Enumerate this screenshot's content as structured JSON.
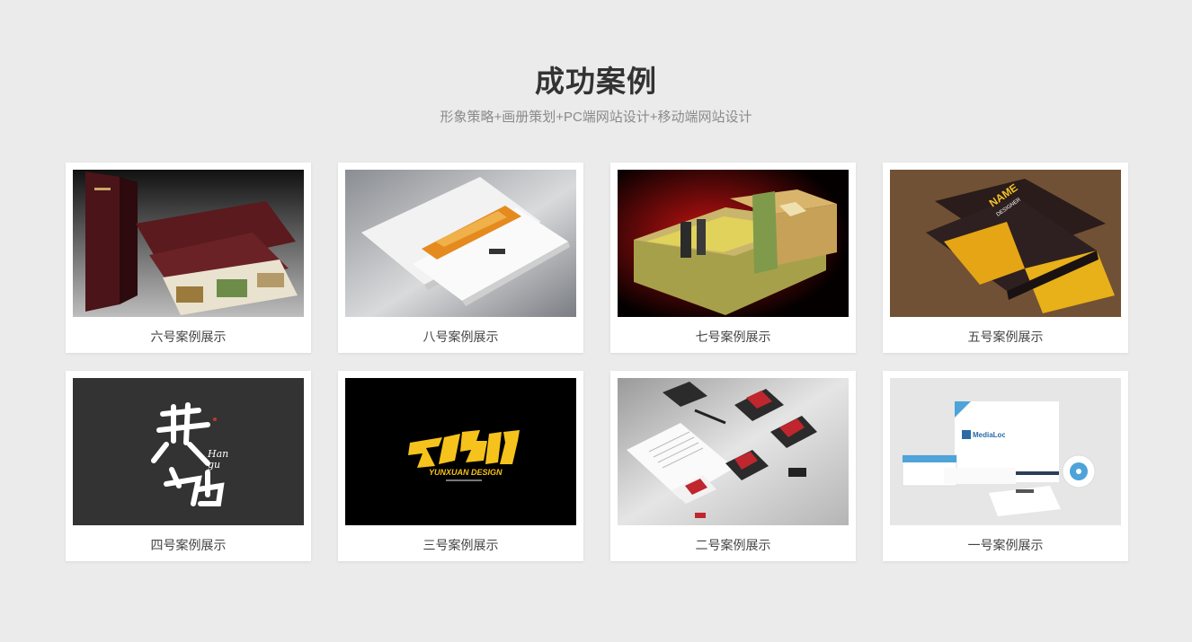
{
  "section": {
    "title": "成功案例",
    "subtitle": "形象策略+画册策划+PC端网站设计+移动端网站设计"
  },
  "cases": [
    {
      "label": "六号案例展示",
      "image": "brochure-maroon"
    },
    {
      "label": "八号案例展示",
      "image": "album-white"
    },
    {
      "label": "七号案例展示",
      "image": "gift-box"
    },
    {
      "label": "五号案例展示",
      "image": "business-card",
      "image_text": [
        "NAME",
        "DESIGNER"
      ]
    },
    {
      "label": "四号案例展示",
      "image": "calligraphy-logo",
      "image_text": [
        "Han",
        "gu"
      ]
    },
    {
      "label": "三号案例展示",
      "image": "yunxuan-logo",
      "image_text": [
        "YUNXUAN DESIGN"
      ]
    },
    {
      "label": "二号案例展示",
      "image": "stationery-red"
    },
    {
      "label": "一号案例展示",
      "image": "stationery-blue",
      "image_text": [
        "MediaLoot"
      ]
    }
  ]
}
